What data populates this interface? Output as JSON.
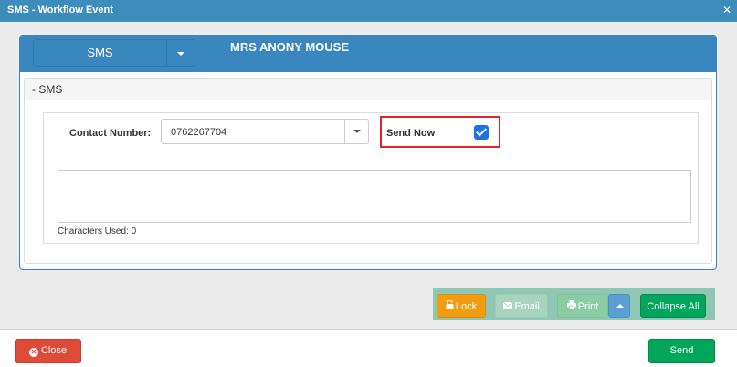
{
  "window": {
    "title": "SMS - Workflow Event",
    "close_glyph": "✕"
  },
  "header": {
    "event_type": "SMS",
    "patient_name": "MRS ANONY MOUSE"
  },
  "section": {
    "title": "- SMS"
  },
  "form": {
    "contact_label": "Contact Number:",
    "contact_value": "0762267704",
    "send_now_label": "Send Now",
    "send_now_checked": true,
    "message_value": "",
    "chars_used": "Characters Used: 0"
  },
  "toolbar": {
    "lock_label": "Lock",
    "email_label": "Email",
    "print_label": "Print",
    "collapse_label": "Collapse All"
  },
  "footer": {
    "close_label": "Close",
    "send_label": "Send"
  },
  "icons": {
    "lock": "lock-icon",
    "email": "envelope-icon",
    "print": "printer-icon",
    "close": "close-circle-icon"
  },
  "colors": {
    "primary": "#3a87c0",
    "warning": "#f39c12",
    "success": "#00a65a",
    "danger": "#dd4b39",
    "highlight": "#e0242a"
  }
}
